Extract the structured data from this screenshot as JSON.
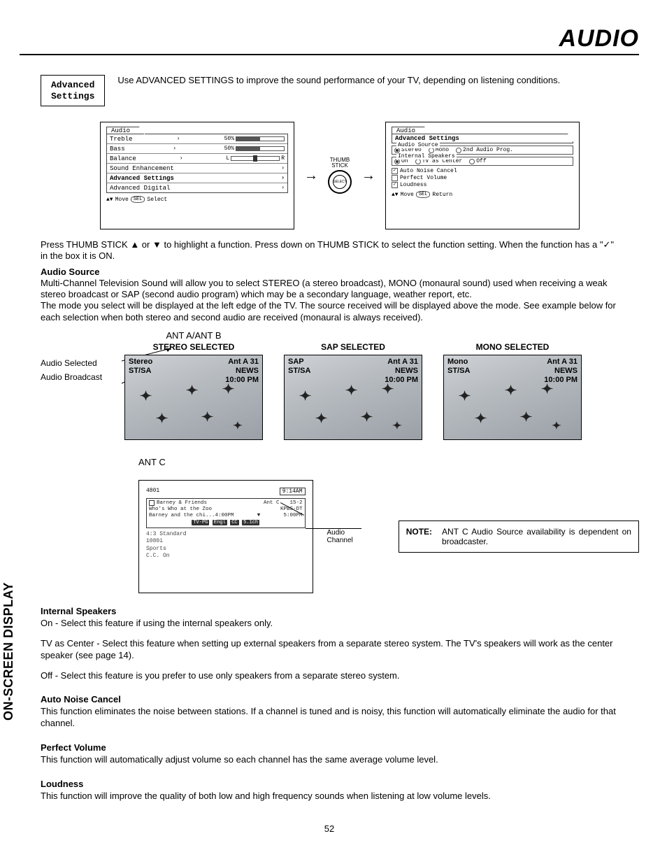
{
  "page": {
    "title": "AUDIO",
    "side_label": "ON-SCREEN DISPLAY",
    "number": "52"
  },
  "advanced_box": {
    "line1": "Advanced",
    "line2": "Settings"
  },
  "intro": "Use ADVANCED SETTINGS to improve the sound performance of your TV, depending on listening conditions.",
  "menu_left": {
    "tab": "Audio",
    "items": [
      "Treble",
      "Bass",
      "Balance",
      "Sound Enhancement",
      "Advanced Settings",
      "Advanced Digital"
    ],
    "treble_pct": "50%",
    "bass_pct": "50%",
    "balance_l": "L",
    "balance_r": "R",
    "footer_move": "Move",
    "footer_select": "Select"
  },
  "thumb": {
    "label": "THUMB\nSTICK",
    "button": "SELECT"
  },
  "menu_right": {
    "tab": "Audio",
    "header": "Advanced Settings",
    "audio_source": {
      "legend": "Audio Source",
      "opts": [
        "Stereo",
        "Mono",
        "2nd Audio Prog."
      ],
      "selected": 0
    },
    "internal_speakers": {
      "legend": "Internal Speakers",
      "opts": [
        "On",
        "TV as Center",
        "Off"
      ],
      "selected": 0
    },
    "checks": [
      {
        "label": "Auto Noise Cancel",
        "on": true
      },
      {
        "label": "Perfect Volume",
        "on": false
      },
      {
        "label": "Loudness",
        "on": true
      }
    ],
    "footer_move": "Move",
    "footer_return": "Return"
  },
  "instruction": "Press THUMB STICK ▲ or ▼ to highlight a function. Press down on THUMB STICK to select the function setting. When the function has a \"✓\" in  the box it is ON.",
  "audio_source": {
    "head": "Audio Source",
    "p1": "Multi-Channel Television Sound will allow you to select STEREO (a stereo broadcast), MONO (monaural sound) used when receiving a weak stereo broadcast or SAP (second audio program) which may be a secondary language, weather report, etc.",
    "p2": "The mode you select will be displayed at the left edge of the TV.  The source received will be displayed above the mode.  See example below for each selection when both stereo and second audio are received (monaural is always received)."
  },
  "callouts": {
    "selected": "Audio Selected",
    "broadcast": "Audio Broadcast"
  },
  "ant_ab": "ANT A/ANT B",
  "examples": {
    "stereo": {
      "head": "STEREO SELECTED",
      "l1": "Stereo",
      "l2": "ST/SA",
      "r1": "Ant A 31",
      "r2": "NEWS",
      "r3": "10:00 PM"
    },
    "sap": {
      "head": "SAP SELECTED",
      "l1": "SAP",
      "l2": "ST/SA",
      "r1": "Ant A 31",
      "r2": "NEWS",
      "r3": "10:00 PM"
    },
    "mono": {
      "head": "MONO SELECTED",
      "l1": "Mono",
      "l2": "ST/SA",
      "r1": "Ant A 31",
      "r2": "NEWS",
      "r3": "10:00 PM"
    }
  },
  "antc": {
    "head": "ANT C",
    "ch": "4801",
    "time": "9:14AM",
    "title": "Barney & Friends",
    "ant": "Ant C",
    "num": "15-2",
    "sub1": "Who's Who at the Zoo",
    "station": "KPBS-DT",
    "sub2": "Barney and the chi...4:00PM",
    "end": "5:00PM",
    "tags": [
      "TV-PG",
      "Engl",
      "CC",
      "5.1ch"
    ],
    "meta": [
      "4:3 Standard",
      "1080i",
      "Sports",
      "C.C. On"
    ],
    "callout": "Audio Channel"
  },
  "note": {
    "label": "NOTE:",
    "text": "ANT C Audio Source availability is dependent on broadcaster."
  },
  "internal": {
    "head": "Internal Speakers",
    "on": "On - Select this feature if using the internal speakers only.",
    "center": "TV as Center - Select this feature when setting up external speakers from a separate stereo system.  The TV's speakers will work as the center speaker (see page 14).",
    "off": "Off - Select this feature is you prefer to use only speakers from a separate stereo system."
  },
  "anc": {
    "head": "Auto Noise Cancel",
    "text": "This function eliminates the noise between stations. If a channel is tuned and is noisy, this function will automatically eliminate the audio for that channel."
  },
  "pv": {
    "head": "Perfect Volume",
    "text": "This function will automatically adjust volume so each channel has the same average volume level."
  },
  "loud": {
    "head": "Loudness",
    "text": "This function will improve the quality of both low and high frequency sounds when listening at low volume levels."
  }
}
